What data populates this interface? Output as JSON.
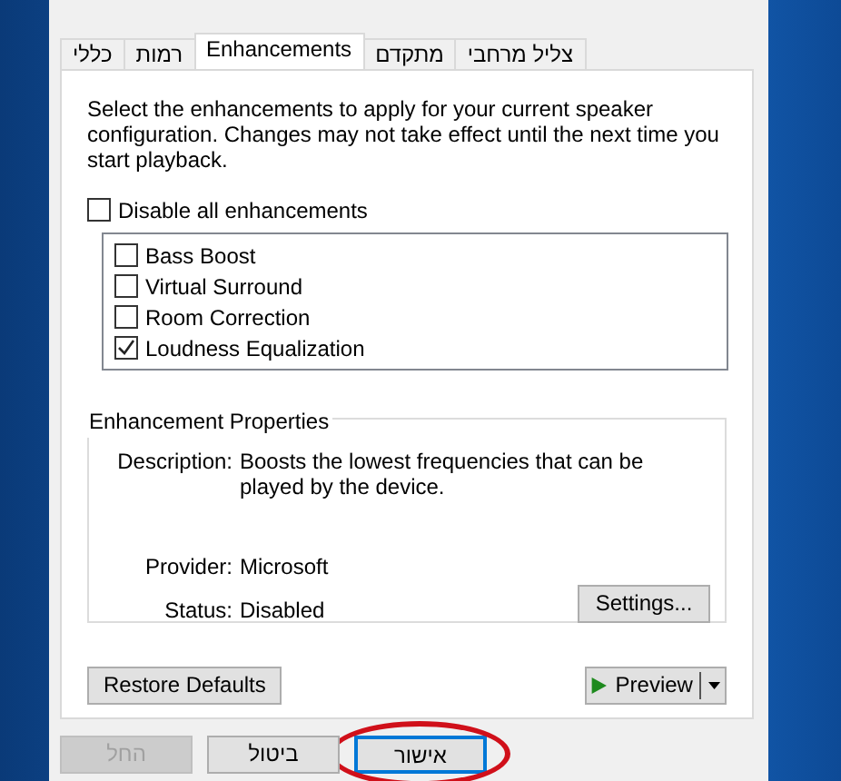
{
  "tabs": [
    {
      "label": "צליל מרחבי",
      "selected": false
    },
    {
      "label": "מתקדם",
      "selected": false
    },
    {
      "label": "Enhancements",
      "selected": true
    },
    {
      "label": "רמות",
      "selected": false
    },
    {
      "label": "כללי",
      "selected": false
    }
  ],
  "intro": "Select the enhancements to apply for your current speaker configuration. Changes may not take effect until the next time you start playback.",
  "disable_all": {
    "label": "Disable all enhancements",
    "checked": false
  },
  "enhancements": [
    {
      "label": "Bass Boost",
      "checked": false
    },
    {
      "label": "Virtual Surround",
      "checked": false
    },
    {
      "label": "Room Correction",
      "checked": false
    },
    {
      "label": "Loudness Equalization",
      "checked": true
    }
  ],
  "properties": {
    "title": "Enhancement Properties",
    "fields": [
      {
        "label": "Description:",
        "value": "Boosts the lowest frequencies that can be played by the device."
      },
      {
        "label": "Provider:",
        "value": "Microsoft"
      },
      {
        "label": "Status:",
        "value": "Disabled"
      }
    ],
    "settings_button": "Settings..."
  },
  "restore_button": "Restore Defaults",
  "preview_button": "Preview",
  "dialog_buttons": [
    {
      "label": "אישור",
      "disabled": false,
      "highlighted": true
    },
    {
      "label": "ביטול",
      "disabled": false,
      "highlighted": false
    },
    {
      "label": "החל",
      "disabled": true,
      "highlighted": false
    }
  ]
}
